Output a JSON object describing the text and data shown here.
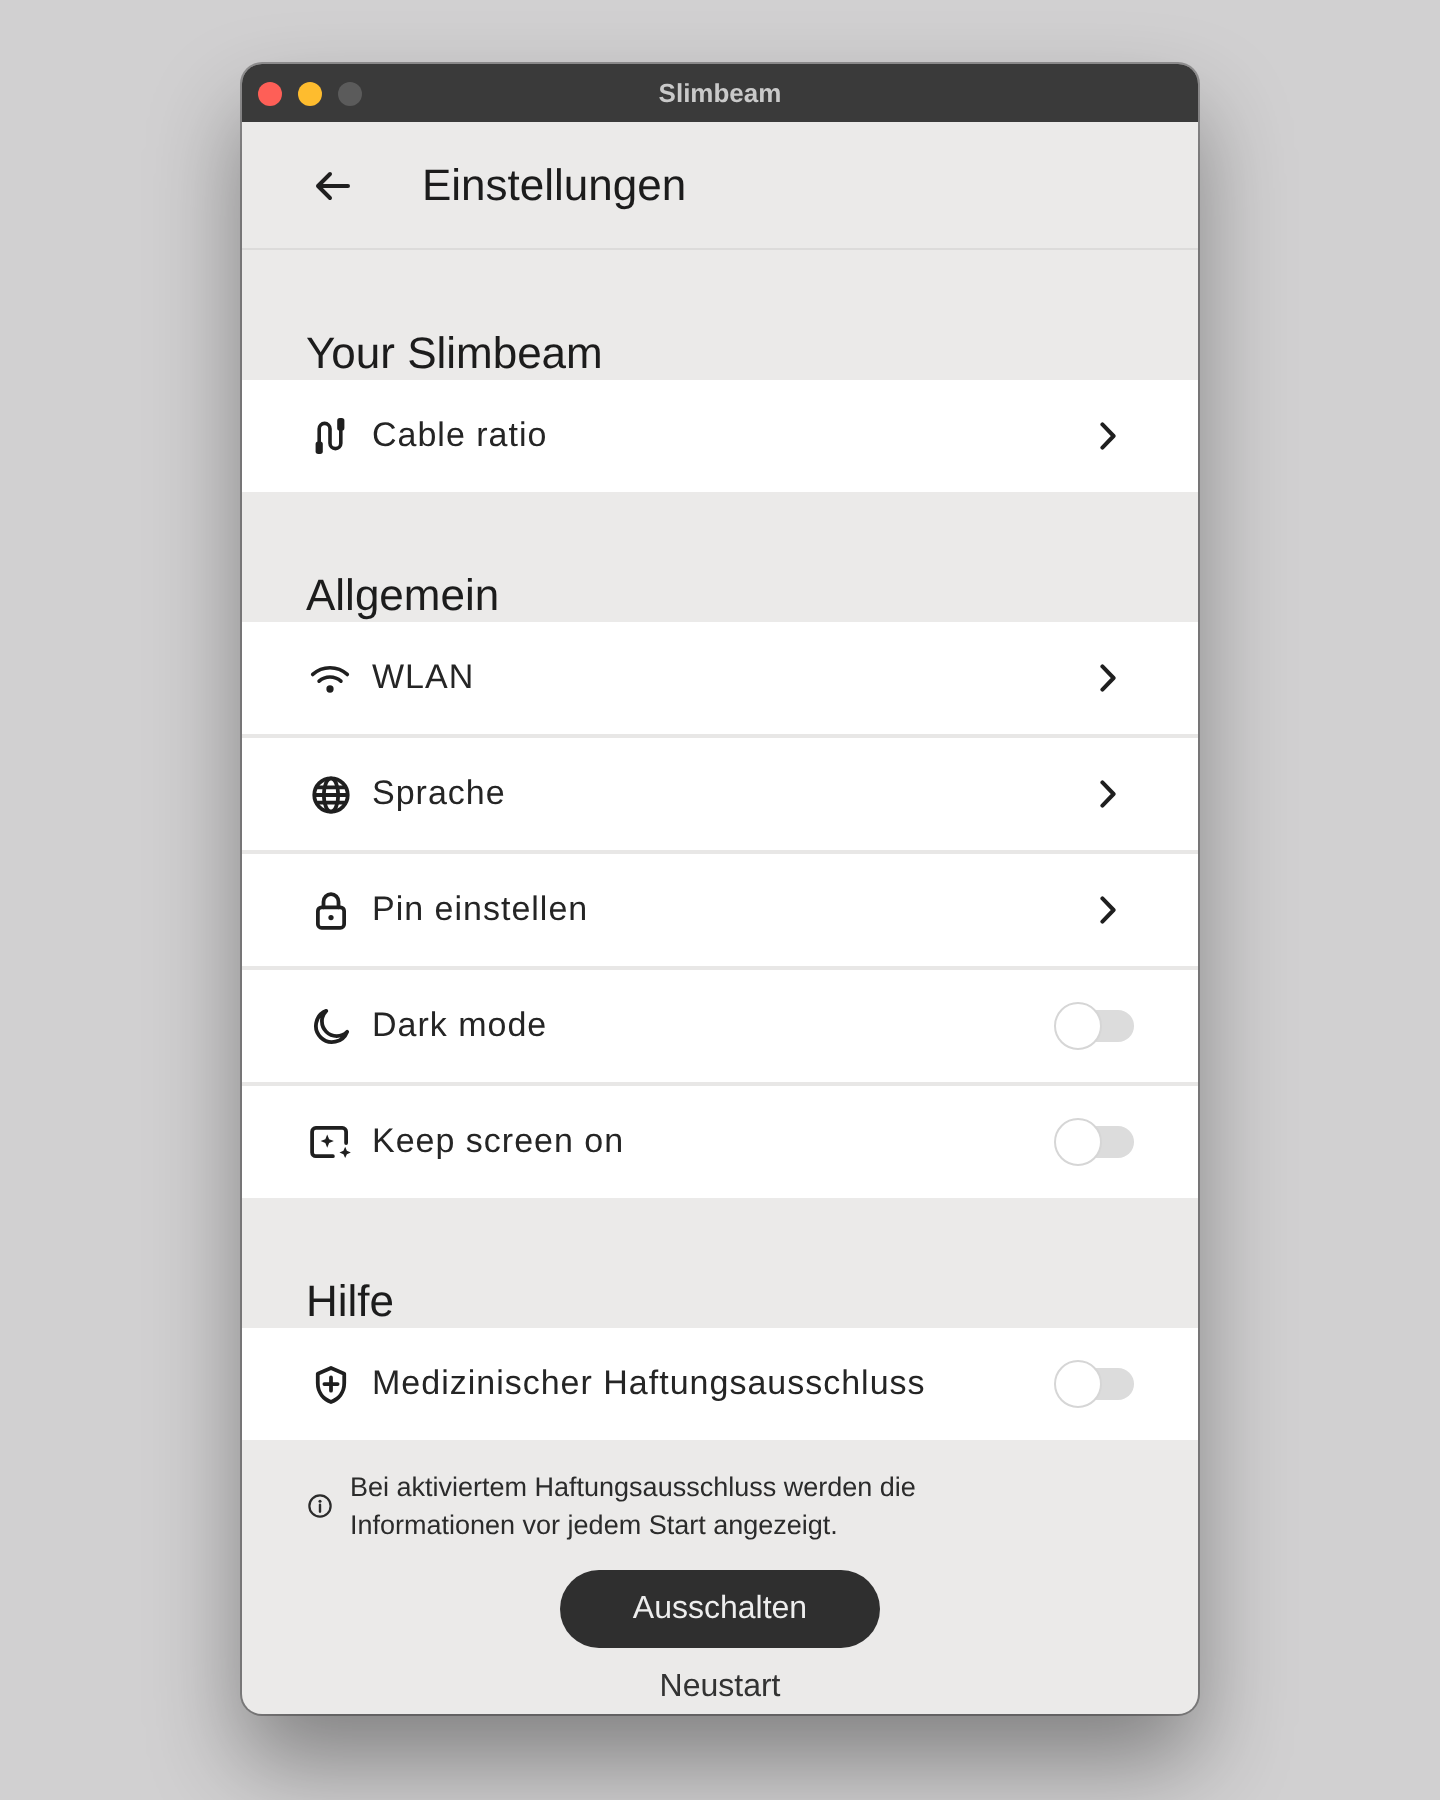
{
  "window": {
    "title": "Slimbeam",
    "zoom_disabled": true
  },
  "header": {
    "title": "Einstellungen"
  },
  "sections": [
    {
      "title": "Your Slimbeam",
      "items": [
        {
          "kind": "link",
          "label": "Cable ratio"
        }
      ]
    },
    {
      "title": "Allgemein",
      "items": [
        {
          "kind": "link",
          "label": "WLAN"
        },
        {
          "kind": "link",
          "label": "Sprache"
        },
        {
          "kind": "link",
          "label": "Pin einstellen"
        },
        {
          "kind": "toggle",
          "label": "Dark mode",
          "on": false
        },
        {
          "kind": "toggle",
          "label": "Keep screen on",
          "on": false
        }
      ]
    },
    {
      "title": "Hilfe",
      "items": [
        {
          "kind": "toggle",
          "label": "Medizinischer Haftungsausschluss",
          "on": false
        }
      ]
    }
  ],
  "footer": {
    "note": "Bei aktiviertem Haftungsausschluss werden die Informationen vor jedem Start angezeigt.",
    "primary_button": "Ausschalten",
    "secondary_link": "Neustart"
  }
}
